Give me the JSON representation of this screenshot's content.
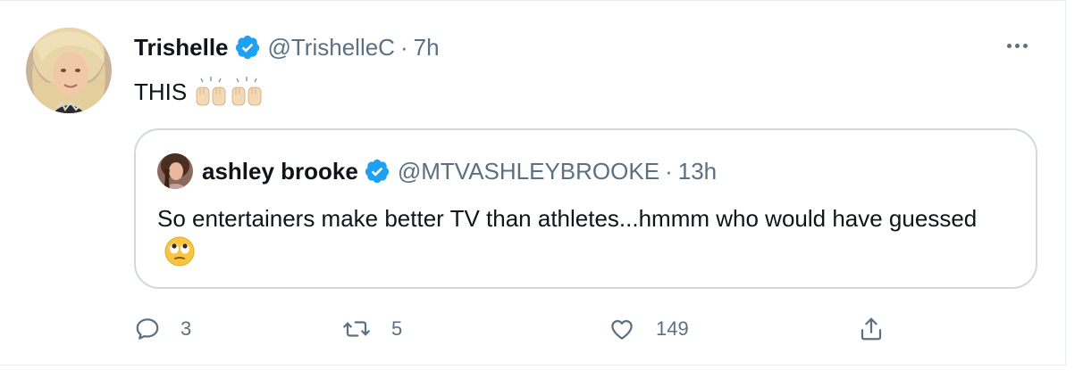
{
  "tweet": {
    "display_name": "Trishelle",
    "handle": "@TrishelleC",
    "separator": "·",
    "time": "7h",
    "text": "THIS",
    "emoji": "raised-hands-emoji"
  },
  "quoted_tweet": {
    "display_name": "ashley brooke",
    "handle": "@MTVASHLEYBROOKE",
    "separator": "·",
    "time": "13h",
    "text": "So entertainers make better TV than athletes...hmmm who would have guessed",
    "emoji": "face-with-rolling-eyes-emoji"
  },
  "actions": {
    "reply_count": "3",
    "retweet_count": "5",
    "like_count": "149"
  },
  "colors": {
    "verified": "#1da1f2",
    "secondary_text": "#5b7083",
    "border": "#cfd9de"
  },
  "icons": {
    "more": "more-icon",
    "reply": "reply-icon",
    "retweet": "retweet-icon",
    "like": "heart-icon",
    "share": "share-icon",
    "verified": "verified-badge-icon"
  }
}
